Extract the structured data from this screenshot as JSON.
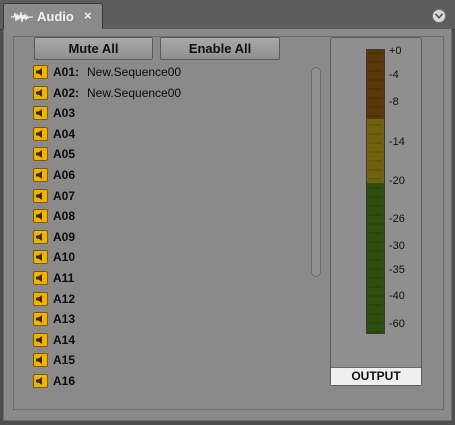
{
  "tab": {
    "title": "Audio",
    "close_glyph": "×",
    "icon": "audio-waveform-icon"
  },
  "panel_menu": {
    "icon": "chevron-down-circle-icon"
  },
  "buttons": {
    "mute_all": "Mute All",
    "enable_all": "Enable All"
  },
  "tracks": [
    {
      "name": "A01:",
      "sequence": "New.Sequence00"
    },
    {
      "name": "A02:",
      "sequence": "New.Sequence00"
    },
    {
      "name": "A03",
      "sequence": ""
    },
    {
      "name": "A04",
      "sequence": ""
    },
    {
      "name": "A05",
      "sequence": ""
    },
    {
      "name": "A06",
      "sequence": ""
    },
    {
      "name": "A07",
      "sequence": ""
    },
    {
      "name": "A08",
      "sequence": ""
    },
    {
      "name": "A09",
      "sequence": ""
    },
    {
      "name": "A10",
      "sequence": ""
    },
    {
      "name": "A11",
      "sequence": ""
    },
    {
      "name": "A12",
      "sequence": ""
    },
    {
      "name": "A13",
      "sequence": ""
    },
    {
      "name": "A14",
      "sequence": ""
    },
    {
      "name": "A15",
      "sequence": ""
    },
    {
      "name": "A16",
      "sequence": ""
    }
  ],
  "meter": {
    "scale": [
      "+0",
      "-4",
      "-8",
      "-14",
      "-20",
      "-26",
      "-30",
      "-35",
      "-40",
      "-60"
    ],
    "zones": [
      {
        "name": "high",
        "color": "#5a3708"
      },
      {
        "name": "mid",
        "color": "#6f6310"
      },
      {
        "name": "low",
        "color": "#2d5010"
      }
    ],
    "label": "OUTPUT"
  },
  "colors": {
    "speaker_icon": "#f0b400"
  }
}
